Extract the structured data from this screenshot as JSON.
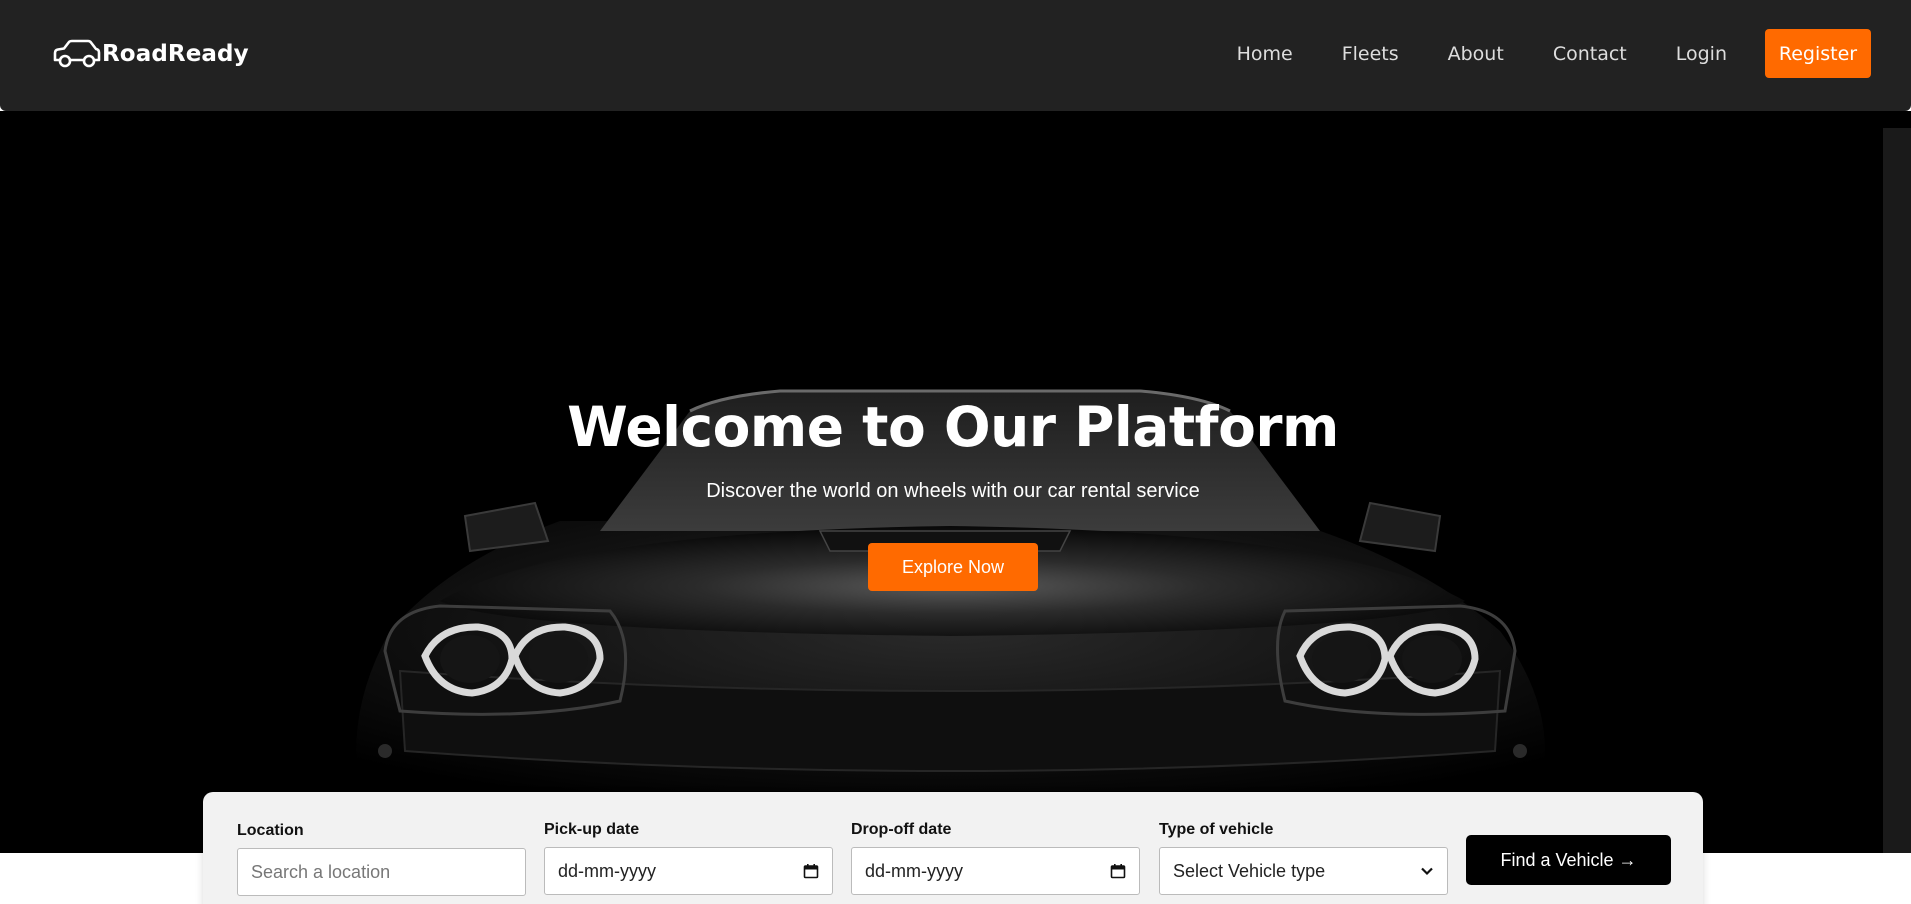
{
  "brand": {
    "name": "RoadReady",
    "icon": "car-icon"
  },
  "nav": {
    "links": [
      "Home",
      "Fleets",
      "About",
      "Contact",
      "Login"
    ],
    "register_label": "Register"
  },
  "hero": {
    "title": "Welcome to Our Platform",
    "subtitle": "Discover the world on wheels with our car rental service",
    "cta_label": "Explore Now"
  },
  "search": {
    "location": {
      "label": "Location",
      "placeholder": "Search a location"
    },
    "pickup": {
      "label": "Pick-up date",
      "value": "dd-mm-yyyy"
    },
    "dropoff": {
      "label": "Drop-off date",
      "value": "dd-mm-yyyy"
    },
    "vehicle": {
      "label": "Type of vehicle",
      "selected": "Select Vehicle type"
    },
    "submit_label": "Find a Vehicle →"
  },
  "colors": {
    "accent": "#ff6a00",
    "navbar": "#222222",
    "hero_bg": "#000000",
    "panel_bg": "#f2f2f2"
  }
}
